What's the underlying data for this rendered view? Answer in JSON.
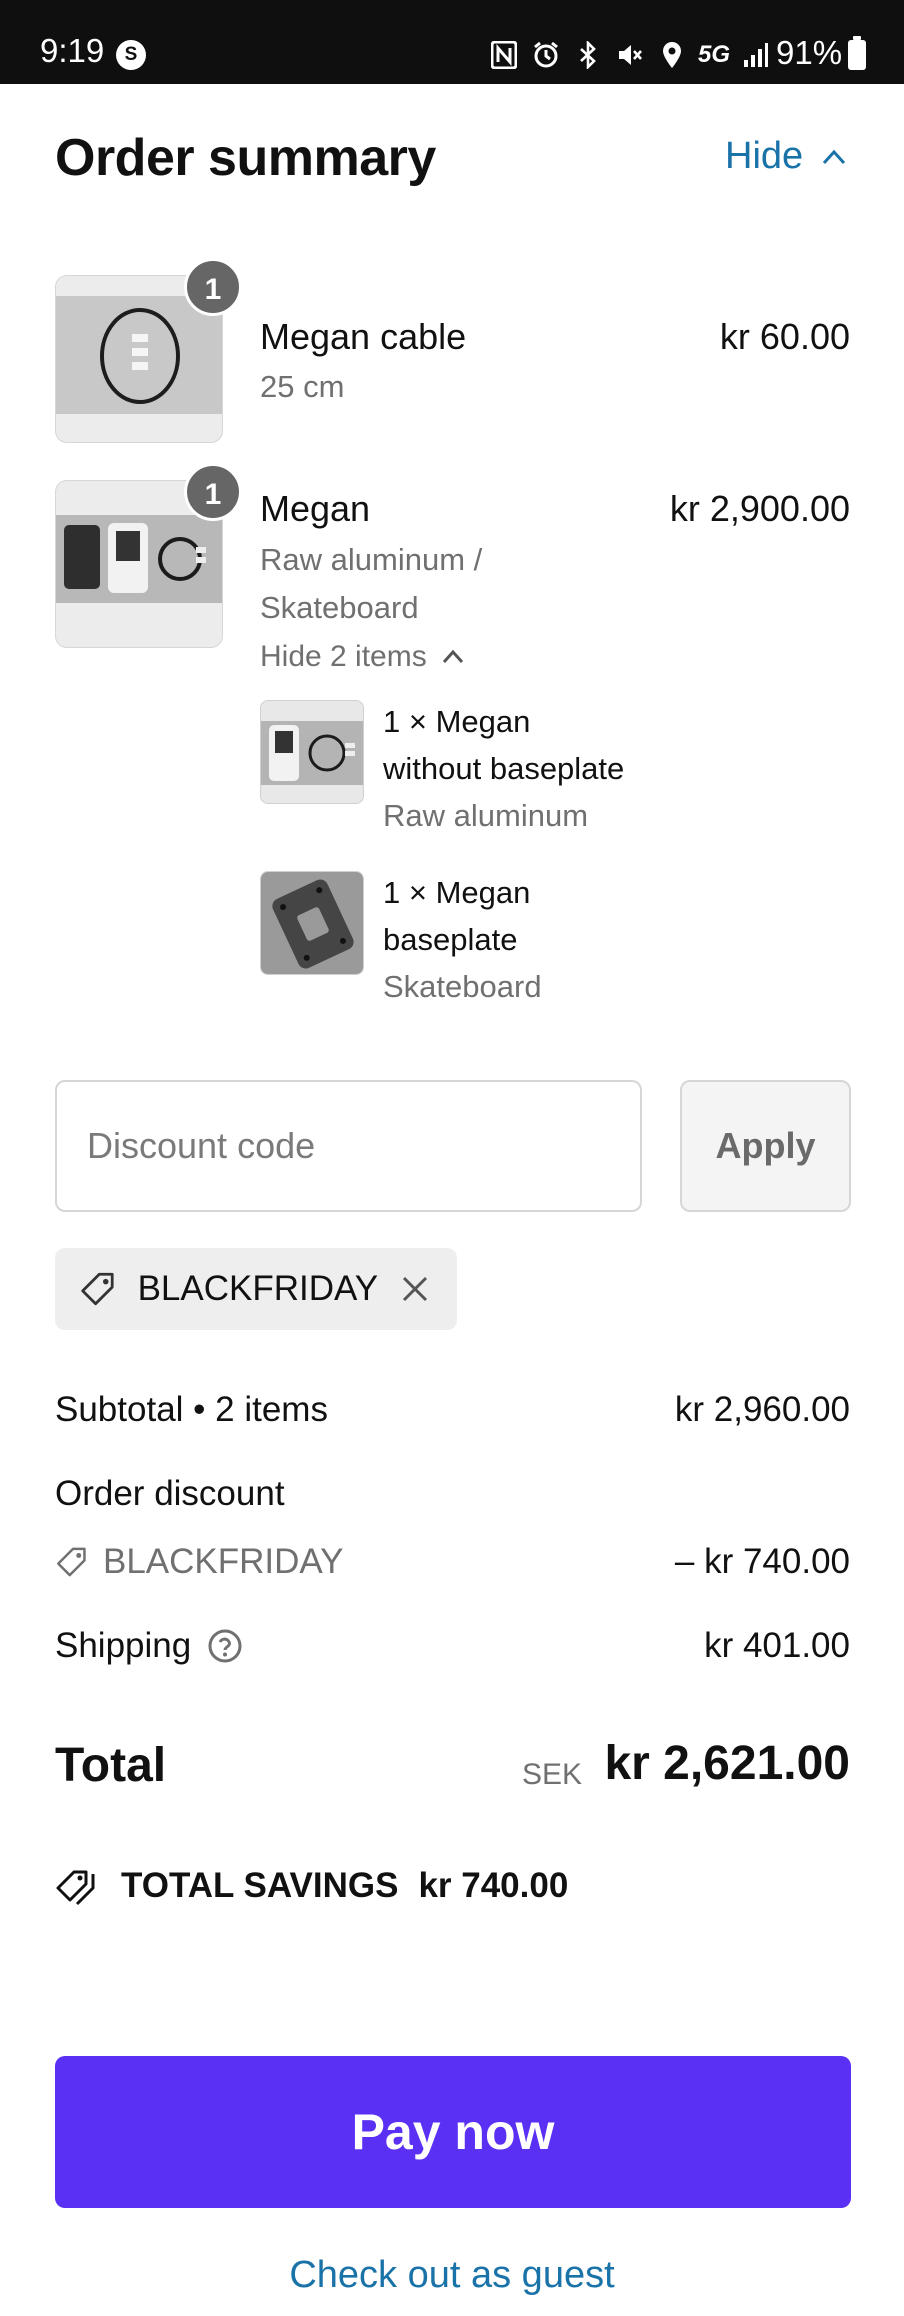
{
  "status_bar": {
    "time": "9:19",
    "app_icon_letter": "S",
    "network": "5G",
    "battery_percent": "91%"
  },
  "header": {
    "title": "Order summary",
    "toggle_label": "Hide"
  },
  "items": [
    {
      "name": "Megan cable",
      "variant": "25 cm",
      "price": "kr 60.00",
      "quantity": "1"
    },
    {
      "name": "Megan",
      "variant_line1": "Raw aluminum /",
      "variant_line2": "Skateboard",
      "price": "kr 2,900.00",
      "quantity": "1",
      "bundle_toggle": "Hide 2 items",
      "components": [
        {
          "line1": "1 × Megan",
          "line2": "without baseplate",
          "variant": "Raw aluminum"
        },
        {
          "line1": "1 × Megan",
          "line2": "baseplate",
          "variant": "Skateboard"
        }
      ]
    }
  ],
  "discount": {
    "placeholder": "Discount code",
    "apply_label": "Apply",
    "applied_code": "BLACKFRIDAY"
  },
  "summary": {
    "subtotal_label": "Subtotal • 2 items",
    "subtotal_value": "kr 2,960.00",
    "order_discount_label": "Order discount",
    "discount_code": "BLACKFRIDAY",
    "discount_value": "– kr 740.00",
    "shipping_label": "Shipping",
    "shipping_value": "kr 401.00",
    "total_label": "Total",
    "currency": "SEK",
    "total_value": "kr 2,621.00",
    "savings_label": "TOTAL SAVINGS",
    "savings_value": "kr 740.00"
  },
  "actions": {
    "pay_label": "Pay now",
    "guest_label": "Check out as guest"
  },
  "colors": {
    "accent_link": "#1a73a8",
    "pay_button": "#5a31f4",
    "muted_text": "#707070"
  }
}
